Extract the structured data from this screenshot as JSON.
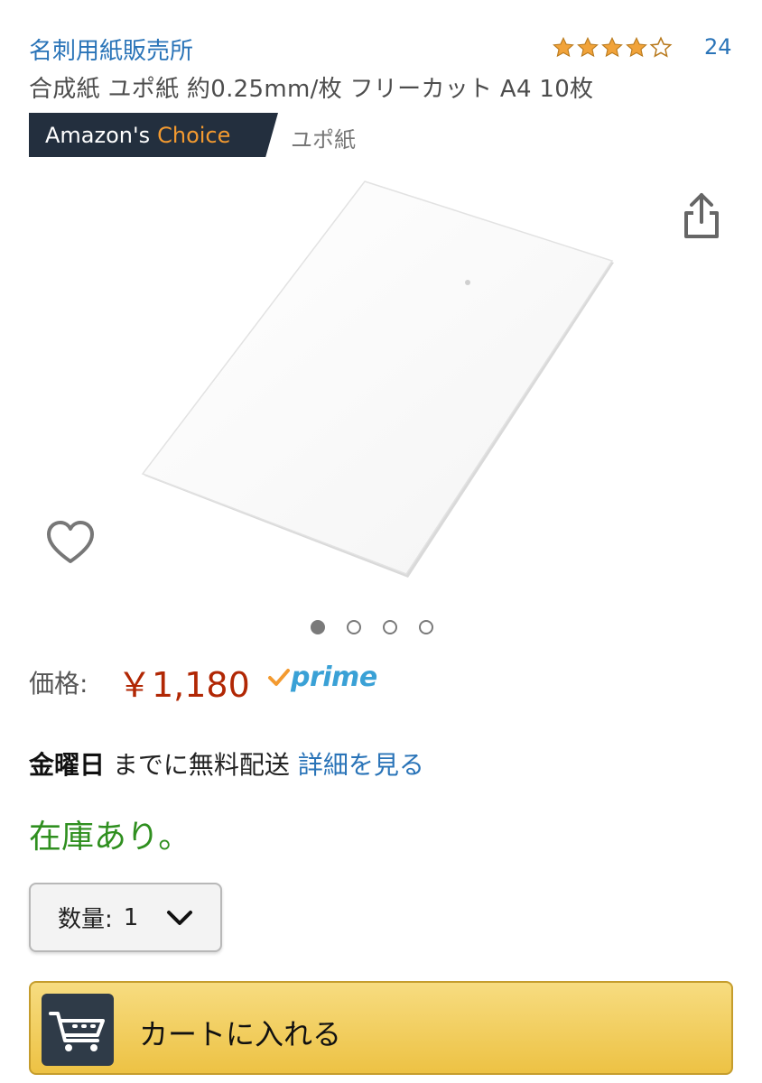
{
  "header": {
    "brand": "名刺用紙販売所",
    "rating_stars": 4,
    "rating_count": "24",
    "product_title": "合成紙 ユポ紙 約0.25mm/枚 フリーカット A4 10枚"
  },
  "badge": {
    "prefix": "Amazon's",
    "highlight": "Choice",
    "category": "ユポ紙"
  },
  "icons": {
    "share": "share-icon",
    "wishlist": "heart-icon",
    "cart": "cart-icon",
    "chevron": "chevron-down-icon"
  },
  "gallery": {
    "image_count": 4,
    "active_index": 0
  },
  "price": {
    "label": "価格:",
    "value": "￥1,180",
    "prime_text": "prime"
  },
  "delivery": {
    "day": "金曜日",
    "text": "までに無料配送",
    "details_link": "詳細を見る"
  },
  "stock": {
    "text": "在庫あり。"
  },
  "quantity": {
    "label": "数量:",
    "value": "1"
  },
  "cart": {
    "label": "カートに入れる"
  },
  "colors": {
    "link_blue": "#2a74b8",
    "price_red": "#b12704",
    "stock_green": "#2f8f1f",
    "badge_dark": "#232f3e",
    "badge_orange": "#f39a30",
    "star_gold": "#f1a33a",
    "prime_blue": "#3aa1d6",
    "cart_yellow": "#f0c850"
  }
}
